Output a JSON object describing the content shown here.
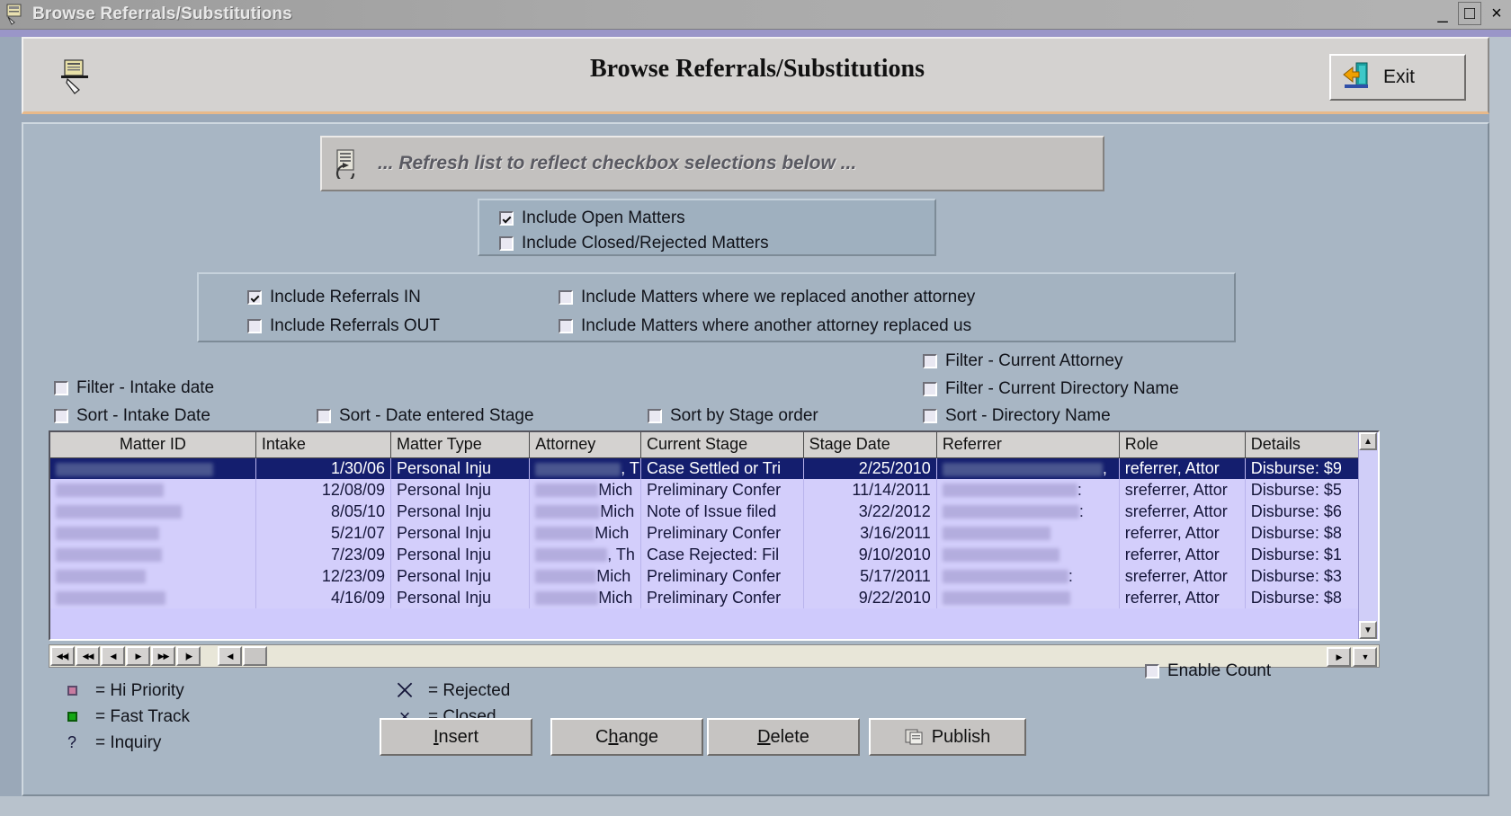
{
  "window": {
    "title": "Browse Referrals/Substitutions",
    "icon": "app-window-icon",
    "minimize": "_",
    "maximize": "□",
    "close": "×"
  },
  "header": {
    "title": "Browse Referrals/Substitutions",
    "doc_icon": "document-pen-icon",
    "exit_label": "Exit",
    "exit_icon": "exit-door-arrow-icon"
  },
  "refresh_banner": {
    "label": "... Refresh list to reflect checkbox selections below ...",
    "icon": "refresh-list-icon"
  },
  "matters_group": [
    {
      "label": "Include Open Matters",
      "checked": true
    },
    {
      "label": "Include Closed/Rejected Matters",
      "checked": false
    }
  ],
  "referrals_group": {
    "left": [
      {
        "label": "Include Referrals IN",
        "checked": true
      },
      {
        "label": "Include Referrals OUT",
        "checked": false
      }
    ],
    "right": [
      {
        "label": "Include Matters where we replaced another attorney",
        "checked": false
      },
      {
        "label": "Include Matters where another attorney replaced us",
        "checked": false
      }
    ]
  },
  "filter_sort": {
    "col1": [
      {
        "label": "Filter - Intake date",
        "checked": false
      },
      {
        "label": "Sort - Intake Date",
        "checked": false
      }
    ],
    "col2": [
      {
        "label": "Sort - Date entered Stage",
        "checked": false
      }
    ],
    "col3": [
      {
        "label": "Sort by Stage order",
        "checked": false
      }
    ],
    "col4": [
      {
        "label": "Filter - Current Attorney",
        "checked": false
      },
      {
        "label": "Filter - Current Directory Name",
        "checked": false
      },
      {
        "label": "Sort - Directory Name",
        "checked": false
      }
    ]
  },
  "grid": {
    "columns": [
      "Matter ID",
      "Intake",
      "Matter Type",
      "Attorney",
      "Current Stage",
      "Stage Date",
      "Referrer",
      "Role",
      "Details"
    ],
    "rows": [
      {
        "selected": true,
        "matter_id": "",
        "matter_id_redacted": true,
        "intake": "1/30/06",
        "matter_type": "Personal Inju",
        "attorney": ", Th",
        "attorney_redacted": true,
        "current_stage": "Case Settled or Tri",
        "stage_date": "2/25/2010",
        "referrer": ",",
        "referrer_redacted": true,
        "role": "referrer, Attor",
        "details": "Disburse: $9"
      },
      {
        "selected": false,
        "matter_id": "",
        "matter_id_redacted": true,
        "intake": "12/08/09",
        "matter_type": "Personal Inju",
        "attorney": "Mich",
        "attorney_redacted": true,
        "current_stage": "Preliminary Confer",
        "stage_date": "11/14/2011",
        "referrer": ":",
        "referrer_redacted": true,
        "role": "sreferrer, Attor",
        "details": "Disburse: $5"
      },
      {
        "selected": false,
        "matter_id": "",
        "matter_id_redacted": true,
        "intake": "8/05/10",
        "matter_type": "Personal Inju",
        "attorney": "Mich",
        "attorney_redacted": true,
        "current_stage": "Note of Issue filed",
        "stage_date": "3/22/2012",
        "referrer": ":",
        "referrer_redacted": true,
        "role": "sreferrer, Attor",
        "details": "Disburse: $6"
      },
      {
        "selected": false,
        "matter_id": "",
        "matter_id_redacted": true,
        "intake": "5/21/07",
        "matter_type": "Personal Inju",
        "attorney": "Mich",
        "attorney_redacted": true,
        "current_stage": "Preliminary Confer",
        "stage_date": "3/16/2011",
        "referrer": "",
        "referrer_redacted": true,
        "role": "referrer, Attor",
        "details": "Disburse: $8"
      },
      {
        "selected": false,
        "matter_id": "",
        "matter_id_redacted": true,
        "intake": "7/23/09",
        "matter_type": "Personal Inju",
        "attorney": ", Th",
        "attorney_redacted": true,
        "current_stage": "Case Rejected:  Fil",
        "stage_date": "9/10/2010",
        "referrer": "",
        "referrer_redacted": true,
        "role": "referrer, Attor",
        "details": "Disburse: $1"
      },
      {
        "selected": false,
        "matter_id": "",
        "matter_id_redacted": true,
        "intake": "12/23/09",
        "matter_type": "Personal Inju",
        "attorney": "Mich",
        "attorney_redacted": true,
        "current_stage": "Preliminary Confer",
        "stage_date": "5/17/2011",
        "referrer": ":",
        "referrer_redacted": true,
        "role": "sreferrer, Attor",
        "details": "Disburse: $3"
      },
      {
        "selected": false,
        "matter_id": "",
        "matter_id_redacted": true,
        "intake": "4/16/09",
        "matter_type": "Personal Inju",
        "attorney": "Mich",
        "attorney_redacted": true,
        "current_stage": "Preliminary Confer",
        "stage_date": "9/22/2010",
        "referrer": "",
        "referrer_redacted": true,
        "role": "referrer, Attor",
        "details": "Disburse: $8"
      }
    ]
  },
  "navigator": {
    "first": "◀◀|",
    "prev_page": "◀◀",
    "prev": "◀",
    "next": "▶",
    "next_page": "▶▶",
    "last": "|▶",
    "hscroll_left": "◀",
    "hscroll_right": "▶"
  },
  "legend": {
    "col1": [
      {
        "icon": "hi-priority-square-icon",
        "label": "= Hi Priority"
      },
      {
        "icon": "fast-track-square-icon",
        "label": "= Fast Track"
      },
      {
        "icon": "inquiry-question-icon",
        "label": "= Inquiry",
        "glyph": "?"
      }
    ],
    "col2": [
      {
        "icon": "rejected-glyph-icon",
        "label": "= Rejected",
        "glyph": "⨉"
      },
      {
        "icon": "closed-glyph-icon",
        "label": "= Closed",
        "glyph": "×"
      }
    ]
  },
  "enable_count": {
    "label": "Enable Count",
    "checked": false
  },
  "actions": [
    {
      "name": "insert",
      "pre": "",
      "accel": "I",
      "post": "nsert"
    },
    {
      "name": "change",
      "pre": "C",
      "accel": "h",
      "post": "ange"
    },
    {
      "name": "delete",
      "pre": "",
      "accel": "D",
      "post": "elete"
    }
  ],
  "publish": {
    "label": "Publish",
    "icon": "publish-icon"
  }
}
